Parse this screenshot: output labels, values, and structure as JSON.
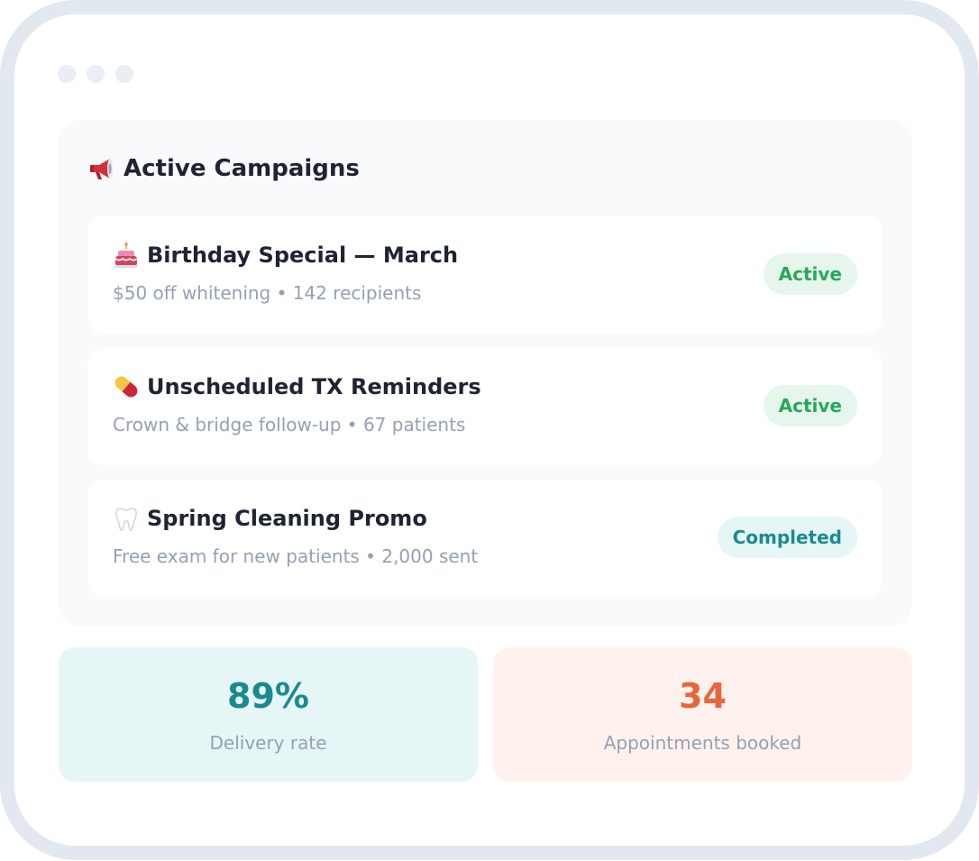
{
  "panel": {
    "title": "Active Campaigns",
    "title_icon": "megaphone-icon"
  },
  "campaigns": [
    {
      "icon": "birthday-cake-icon",
      "name": "Birthday Special — March",
      "details": "$50 off whitening • 142 recipients",
      "status": "Active",
      "status_color": "#25a958"
    },
    {
      "icon": "pill-icon",
      "name": "Unscheduled TX Reminders",
      "details": "Crown & bridge follow-up • 67 patients",
      "status": "Active",
      "status_color": "#25a958"
    },
    {
      "icon": "tooth-icon",
      "name": "Spring Cleaning Promo",
      "details": "Free exam for new patients • 2,000 sent",
      "status": "Completed",
      "status_color": "#1b8a8f"
    }
  ],
  "stats": [
    {
      "value": "89%",
      "label": "Delivery rate",
      "color": "#1b8a8f",
      "background": "#e6f5f6"
    },
    {
      "value": "34",
      "label": "Appointments booked",
      "color": "#e8673a",
      "background": "#fff2ee"
    }
  ]
}
